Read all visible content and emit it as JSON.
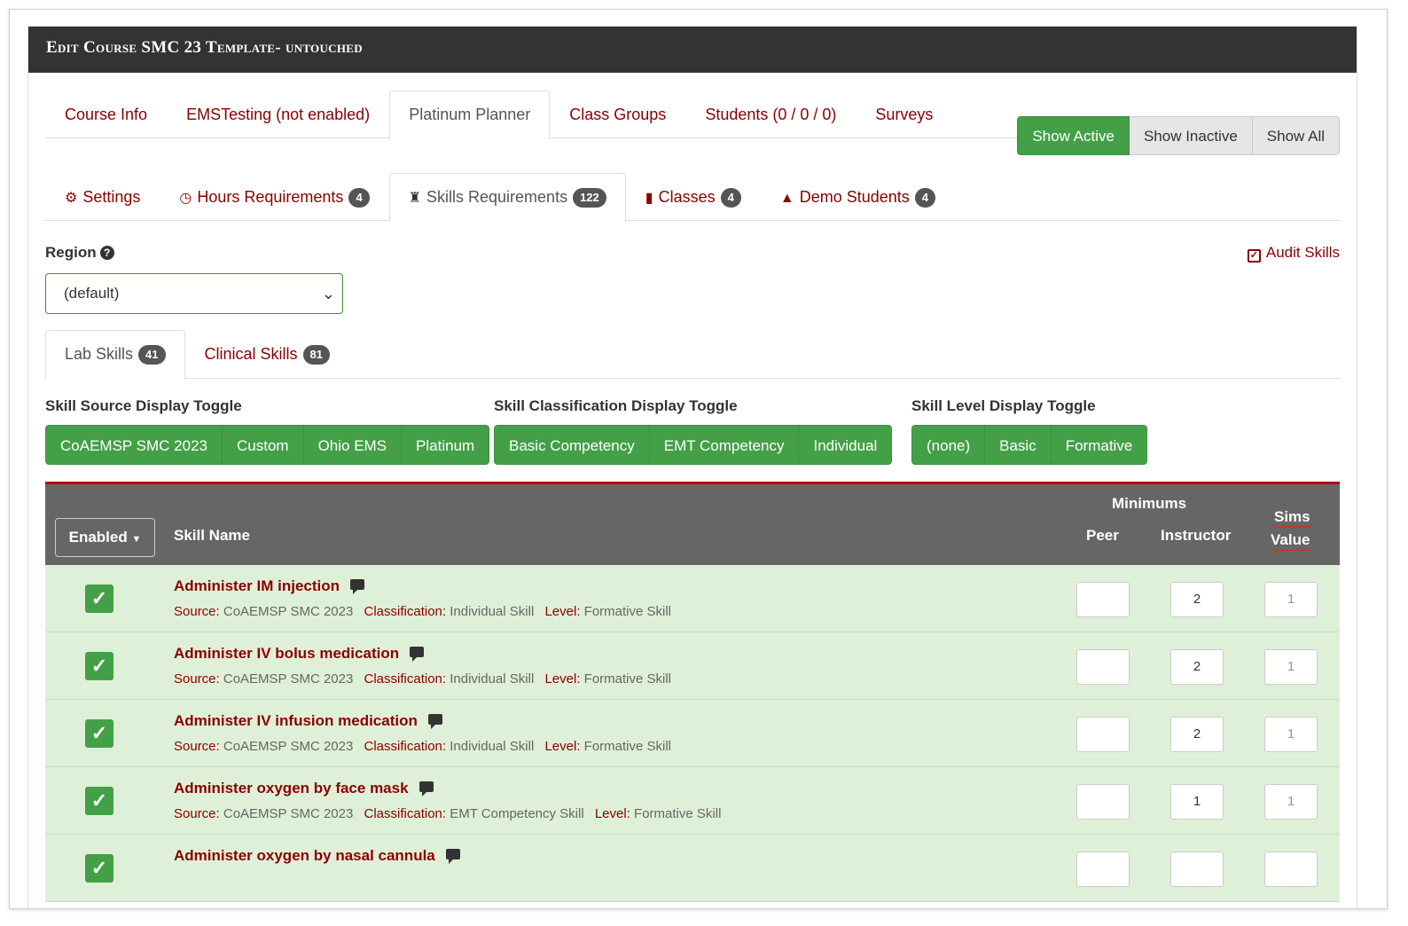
{
  "header": {
    "title": "Edit Course SMC 23 Template- untouched"
  },
  "main_tabs": [
    {
      "label": "Course Info"
    },
    {
      "label": "EMSTesting (not enabled)"
    },
    {
      "label": "Platinum Planner"
    },
    {
      "label": "Class Groups"
    },
    {
      "label": "Students (0 / 0 / 0)"
    },
    {
      "label": "Surveys"
    }
  ],
  "active_main_tab": "Platinum Planner",
  "show_filter": {
    "active": "Show Active",
    "inactive": "Show Inactive",
    "all": "Show All",
    "selected": "Show Active"
  },
  "sub_tabs": [
    {
      "label": "Settings",
      "icon": "gear-icon"
    },
    {
      "label": "Hours Requirements",
      "icon": "clock-icon",
      "count": "4"
    },
    {
      "label": "Skills Requirements",
      "icon": "chess-icon",
      "count": "122"
    },
    {
      "label": "Classes",
      "icon": "book-icon",
      "count": "4"
    },
    {
      "label": "Demo Students",
      "icon": "graduation-cap-icon",
      "count": "4"
    }
  ],
  "region": {
    "label": "Region",
    "value": "(default)"
  },
  "audit": {
    "label": "Audit Skills"
  },
  "skill_tabs": [
    {
      "label": "Lab Skills",
      "count": "41"
    },
    {
      "label": "Clinical Skills",
      "count": "81"
    }
  ],
  "toggles": {
    "source": {
      "label": "Skill Source Display Toggle",
      "options": [
        "CoAEMSP SMC 2023",
        "Custom",
        "Ohio EMS",
        "Platinum"
      ]
    },
    "classification": {
      "label": "Skill Classification Display Toggle",
      "options": [
        "Basic Competency",
        "EMT Competency",
        "Individual"
      ]
    },
    "level": {
      "label": "Skill Level Display Toggle",
      "options": [
        "(none)",
        "Basic",
        "Formative"
      ]
    }
  },
  "table": {
    "enabled_button": "Enabled",
    "col_skill": "Skill Name",
    "col_minimums": "Minimums",
    "col_peer": "Peer",
    "col_instructor": "Instructor",
    "col_sims1": "Sims",
    "col_sims2": "Value",
    "meta_labels": {
      "source": "Source:",
      "classification": "Classification:",
      "level": "Level:"
    },
    "rows": [
      {
        "name": "Administer IM injection",
        "source": "CoAEMSP SMC 2023",
        "classification": "Individual Skill",
        "level": "Formative Skill",
        "peer": "",
        "instructor": "2",
        "sims": "1"
      },
      {
        "name": "Administer IV bolus medication",
        "source": "CoAEMSP SMC 2023",
        "classification": "Individual Skill",
        "level": "Formative Skill",
        "peer": "",
        "instructor": "2",
        "sims": "1"
      },
      {
        "name": "Administer IV infusion medication",
        "source": "CoAEMSP SMC 2023",
        "classification": "Individual Skill",
        "level": "Formative Skill",
        "peer": "",
        "instructor": "2",
        "sims": "1"
      },
      {
        "name": "Administer oxygen by face mask",
        "source": "CoAEMSP SMC 2023",
        "classification": "EMT Competency Skill",
        "level": "Formative Skill",
        "peer": "",
        "instructor": "1",
        "sims": "1"
      },
      {
        "name": "Administer oxygen by nasal cannula",
        "source": "",
        "classification": "",
        "level": "",
        "peer": "",
        "instructor": "",
        "sims": ""
      }
    ]
  },
  "colors": {
    "header_bg": "#333333",
    "link": "#8b0000",
    "green": "#44a047",
    "row_bg": "#dff0d8",
    "table_head": "#666666"
  }
}
